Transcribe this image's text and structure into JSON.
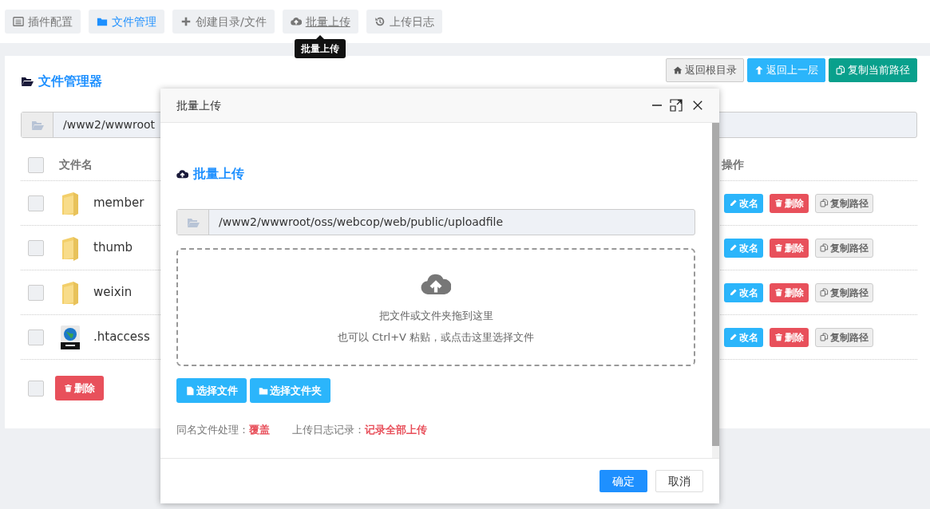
{
  "tabs": [
    {
      "label": "插件配置",
      "kind": "list",
      "selected": false,
      "hover": false
    },
    {
      "label": "文件管理",
      "kind": "folder",
      "selected": true,
      "hover": false
    },
    {
      "label": "创建目录/文件",
      "kind": "create",
      "selected": false,
      "hover": false
    },
    {
      "label": "批量上传",
      "kind": "upload",
      "selected": false,
      "hover": true,
      "tooltip": "批量上传"
    },
    {
      "label": "上传日志",
      "kind": "log",
      "selected": false,
      "hover": false
    }
  ],
  "file_manager": {
    "title": "文件管理器",
    "nav_buttons": [
      {
        "label": "返回根目录",
        "kind": "light"
      },
      {
        "label": "返回上一层",
        "kind": "info"
      },
      {
        "label": "复制当前路径",
        "kind": "teal"
      }
    ],
    "path": "/www2/wwwroot",
    "select_all_checked": false,
    "columns": [
      "文件名",
      "操作"
    ],
    "rows": [
      {
        "name": "member",
        "kind": "folder",
        "checked": false,
        "actions": [
          "改名",
          "删除",
          "复制路径"
        ]
      },
      {
        "name": "thumb",
        "kind": "folder",
        "checked": false,
        "actions": [
          "改名",
          "删除",
          "复制路径"
        ]
      },
      {
        "name": "weixin",
        "kind": "folder",
        "checked": false,
        "actions": [
          "改名",
          "删除",
          "复制路径"
        ]
      },
      {
        "name": ".htaccess",
        "kind": "url",
        "checked": false,
        "actions": [
          "改名",
          "删除",
          "复制路径"
        ]
      }
    ],
    "footer_checked": false,
    "bulk_delete": "删除"
  },
  "dialog": {
    "title": "批量上传",
    "heading": "批量上传",
    "path": "/www2/wwwroot/oss/webcop/web/public/uploadfile",
    "drop_text": "把文件或文件夹拖到这里",
    "drop_hint": "也可以 Ctrl+V 粘贴，或点击这里选择文件",
    "pick_buttons": [
      {
        "label": "选择文件",
        "kind": "file"
      },
      {
        "label": "选择文件夹",
        "kind": "folder"
      }
    ],
    "settings": [
      {
        "label": "同名文件处理：",
        "value": "覆盖"
      },
      {
        "label": "上传日志记录：",
        "value": "记录全部上传"
      }
    ],
    "ok": "确定",
    "cancel": "取消"
  }
}
